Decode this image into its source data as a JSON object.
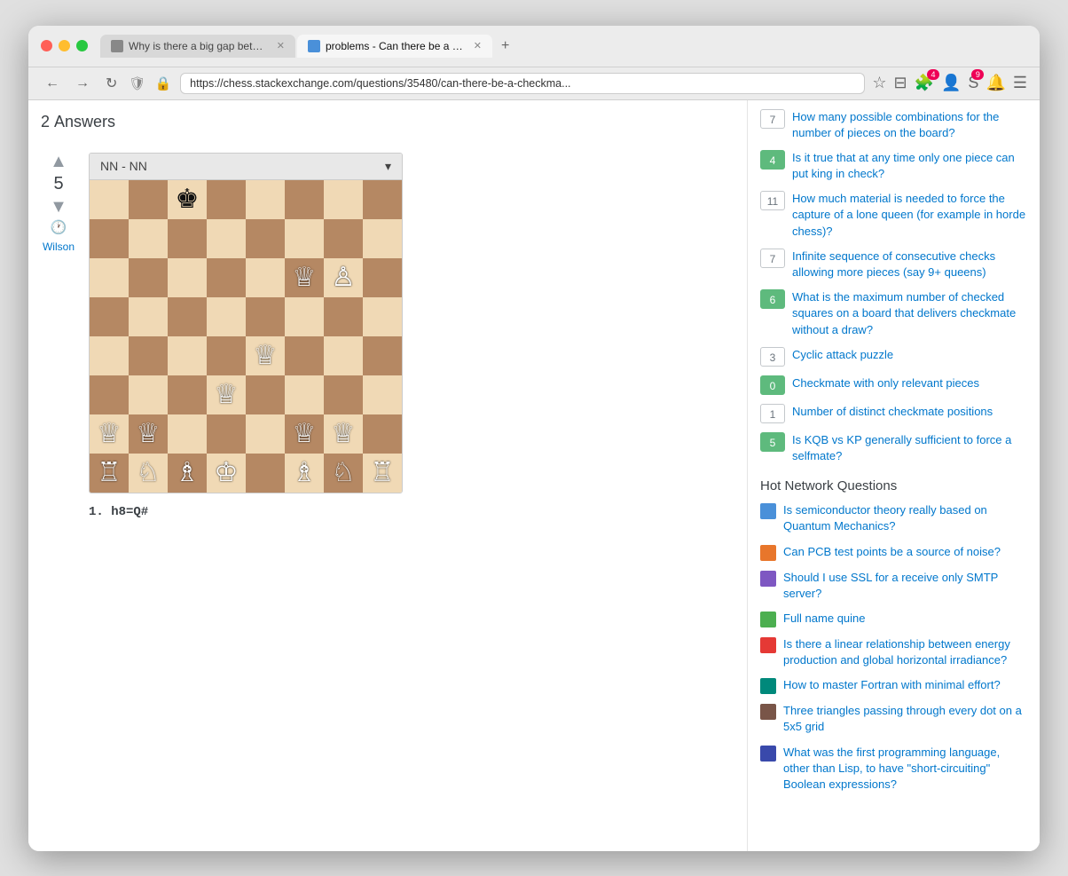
{
  "browser": {
    "tabs": [
      {
        "id": "tab1",
        "title": "Why is there a big gap between...",
        "favicon_type": "se",
        "active": false
      },
      {
        "id": "tab2",
        "title": "problems - Can there be a chec...",
        "favicon_type": "chess",
        "active": true
      }
    ],
    "new_tab_label": "+",
    "address": "https://chess.stackexchange.com/questions/35480/can-there-be-a-checkma...",
    "nav": {
      "back": "←",
      "forward": "→",
      "reload": "↻"
    },
    "toolbar": {
      "shield": "🛡",
      "lock": "🔒",
      "bookmark_star": "☆",
      "bookmark_list": "⊟",
      "extensions_badge": "4",
      "bell_badge": "9"
    }
  },
  "main": {
    "answers_header": "Answers",
    "vote_up": "▲",
    "vote_down": "▼",
    "vote_count": "5",
    "history_icon": "🕐",
    "answerer": "Wilson",
    "board_title": "NN - NN",
    "board_dropdown": "▾",
    "move_notation": "1. h8=Q#",
    "board": [
      [
        "bk",
        "",
        "",
        "",
        "",
        "",
        "",
        ""
      ],
      [
        "",
        "",
        "",
        "",
        "",
        "",
        "",
        ""
      ],
      [
        "",
        "",
        "",
        "",
        "",
        "",
        "",
        ""
      ],
      [
        "",
        "",
        "",
        "",
        "wq",
        "wp",
        "",
        ""
      ],
      [
        "",
        "",
        "",
        "",
        "",
        "",
        "",
        ""
      ],
      [
        "",
        "",
        "",
        "",
        "wq",
        "",
        "",
        ""
      ],
      [
        "",
        "",
        "",
        "",
        "",
        "",
        "",
        ""
      ],
      [
        "wq",
        "wq",
        "",
        "",
        "",
        "wq",
        "wq",
        ""
      ],
      [
        "wr",
        "wn",
        "wb",
        "wk",
        "",
        "wb",
        "wn",
        "wr"
      ]
    ],
    "pieces": {
      "bk": "♚",
      "bq": "♛",
      "br": "♜",
      "bn": "♞",
      "bb": "♝",
      "bp": "♟",
      "wk": "♔",
      "wq": "♕",
      "wr": "♖",
      "wn": "♘",
      "wb": "♗",
      "wp": "♙"
    }
  },
  "sidebar": {
    "linked_items": [
      {
        "score": "7",
        "answered": false,
        "title": "How many possible combinations for the number of pieces on the board?"
      },
      {
        "score": "4",
        "answered": true,
        "title": "Is it true that at any time only one piece can put king in check?"
      },
      {
        "score": "11",
        "answered": false,
        "title": "How much material is needed to force the capture of a lone queen (for example in horde chess)?"
      },
      {
        "score": "7",
        "answered": false,
        "title": "Infinite sequence of consecutive checks allowing more pieces (say 9+ queens)"
      },
      {
        "score": "6",
        "answered": true,
        "title": "What is the maximum number of checked squares on a board that delivers checkmate without a draw?"
      },
      {
        "score": "3",
        "answered": false,
        "title": "Cyclic attack puzzle"
      },
      {
        "score": "0",
        "answered": true,
        "title": "Checkmate with only relevant pieces"
      },
      {
        "score": "1",
        "answered": false,
        "title": "Number of distinct checkmate positions"
      },
      {
        "score": "5",
        "answered": true,
        "title": "Is KQB vs KP generally sufficient to force a selfmate?"
      }
    ],
    "hot_network_title": "Hot Network Questions",
    "hot_items": [
      {
        "icon_type": "blue",
        "title": "Is semiconductor theory really based on Quantum Mechanics?"
      },
      {
        "icon_type": "orange",
        "title": "Can PCB test points be a source of noise?"
      },
      {
        "icon_type": "purple",
        "title": "Should I use SSL for a receive only SMTP server?"
      },
      {
        "icon_type": "green",
        "title": "Full name quine"
      },
      {
        "icon_type": "red",
        "title": "Is there a linear relationship between energy production and global horizontal irradiance?"
      },
      {
        "icon_type": "teal",
        "title": "How to master Fortran with minimal effort?"
      },
      {
        "icon_type": "brown",
        "title": "Three triangles passing through every dot on a 5x5 grid"
      },
      {
        "icon_type": "indigo",
        "title": "What was the first programming language, other than Lisp, to have \"short-circuiting\" Boolean expressions?"
      }
    ]
  }
}
